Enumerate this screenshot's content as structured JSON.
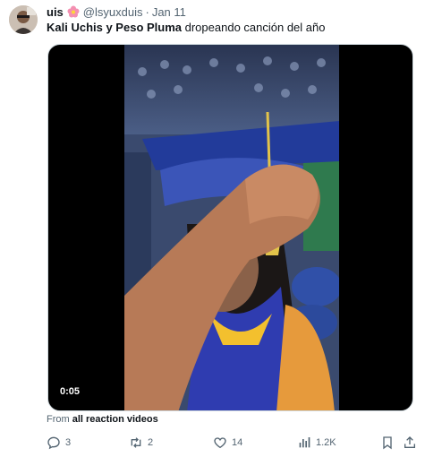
{
  "tweet": {
    "display_name": "uis",
    "emoji": "flower-emoji",
    "handle": "@lsyuxduis",
    "separator": "·",
    "date": "Jan 11",
    "text_bold": "Kali Uchis y Peso Pluma",
    "text_rest": " dropeando canción del año"
  },
  "video": {
    "duration": "0:05"
  },
  "source": {
    "prefix": "From ",
    "name": "all reaction videos"
  },
  "actions": {
    "replies": "3",
    "retweets": "2",
    "likes": "14",
    "views": "1.2K"
  },
  "colors": {
    "text_primary": "#0f1419",
    "text_secondary": "#536471",
    "border": "#cfd9de"
  }
}
